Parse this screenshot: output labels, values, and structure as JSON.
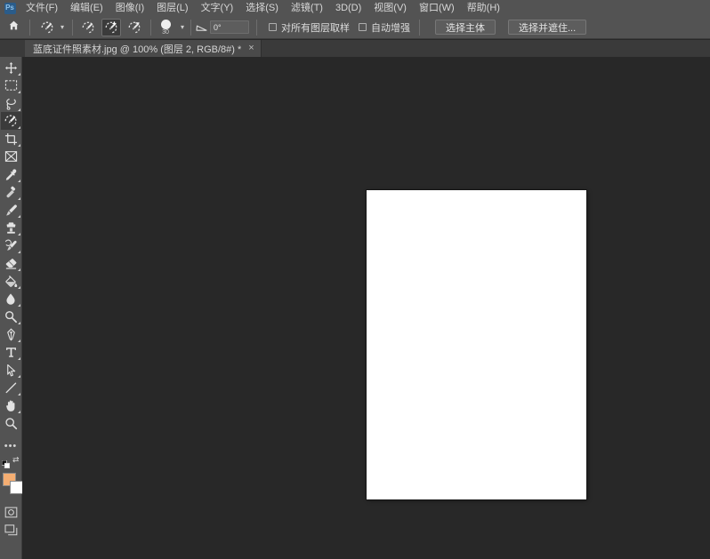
{
  "app": {
    "name": "Adobe Photoshop",
    "logo_text": "Ps",
    "colors": {
      "menubar_bg": "#535353",
      "toolbar_bg": "#535353",
      "canvas_bg": "#282828",
      "tabbar_bg": "#3a3a3a",
      "tab_active_bg": "#4a4a4a",
      "text": "#d8d8d8",
      "foreground_swatch": "#f5ae72",
      "background_swatch": "#ffffff",
      "logo_blue": "#2a5c8a"
    }
  },
  "menubar": {
    "items": [
      {
        "label": "文件(F)",
        "name": "menu-file"
      },
      {
        "label": "编辑(E)",
        "name": "menu-edit"
      },
      {
        "label": "图像(I)",
        "name": "menu-image"
      },
      {
        "label": "图层(L)",
        "name": "menu-layer"
      },
      {
        "label": "文字(Y)",
        "name": "menu-type"
      },
      {
        "label": "选择(S)",
        "name": "menu-select"
      },
      {
        "label": "滤镜(T)",
        "name": "menu-filter"
      },
      {
        "label": "3D(D)",
        "name": "menu-3d"
      },
      {
        "label": "视图(V)",
        "name": "menu-view"
      },
      {
        "label": "窗口(W)",
        "name": "menu-window"
      },
      {
        "label": "帮助(H)",
        "name": "menu-help"
      }
    ]
  },
  "options_bar": {
    "home_icon": "home-icon",
    "tool_preset_icon": "quick-selection-icon",
    "tool_preset_chevron": "chevron-down-icon",
    "modes": [
      {
        "name": "new-selection-mode",
        "icon": "quick-selection-new-icon",
        "active": false
      },
      {
        "name": "add-to-selection-mode",
        "icon": "quick-selection-add-icon",
        "active": true
      },
      {
        "name": "subtract-from-selection-mode",
        "icon": "quick-selection-subtract-icon",
        "active": false
      }
    ],
    "brush_size": "30",
    "brush_chevron": "chevron-down-icon",
    "angle_icon": "angle-icon",
    "angle_value": "0°",
    "checkboxes": [
      {
        "label": "对所有图层取样",
        "name": "sample-all-layers-checkbox",
        "checked": false
      },
      {
        "label": "自动增强",
        "name": "auto-enhance-checkbox",
        "checked": false
      }
    ],
    "buttons": [
      {
        "label": "选择主体",
        "name": "select-subject-button"
      },
      {
        "label": "选择并遮住...",
        "name": "select-and-mask-button"
      }
    ]
  },
  "tabbar": {
    "tabs": [
      {
        "label": "蓝底证件照素材.jpg @ 100% (图层 2, RGB/8#) *",
        "close_icon": "×",
        "name": "document-tab",
        "active": true
      }
    ]
  },
  "toolbar": {
    "tools": [
      {
        "name": "tool-move",
        "icon": "move-icon",
        "selected": false,
        "has_submenu": true
      },
      {
        "name": "tool-rectangular-marquee",
        "icon": "rectangular-marquee-icon",
        "selected": false,
        "has_submenu": true
      },
      {
        "name": "tool-lasso",
        "icon": "lasso-icon",
        "selected": false,
        "has_submenu": true
      },
      {
        "name": "tool-quick-selection",
        "icon": "quick-selection-icon",
        "selected": true,
        "has_submenu": true
      },
      {
        "name": "tool-crop",
        "icon": "crop-icon",
        "selected": false,
        "has_submenu": true
      },
      {
        "name": "tool-frame",
        "icon": "frame-icon",
        "selected": false,
        "has_submenu": false
      },
      {
        "name": "tool-eyedropper",
        "icon": "eyedropper-icon",
        "selected": false,
        "has_submenu": true
      },
      {
        "name": "tool-spot-healing-brush",
        "icon": "spot-healing-brush-icon",
        "selected": false,
        "has_submenu": true
      },
      {
        "name": "tool-brush",
        "icon": "brush-icon",
        "selected": false,
        "has_submenu": true
      },
      {
        "name": "tool-clone-stamp",
        "icon": "clone-stamp-icon",
        "selected": false,
        "has_submenu": true
      },
      {
        "name": "tool-history-brush",
        "icon": "history-brush-icon",
        "selected": false,
        "has_submenu": true
      },
      {
        "name": "tool-eraser",
        "icon": "eraser-icon",
        "selected": false,
        "has_submenu": true
      },
      {
        "name": "tool-gradient",
        "icon": "gradient-paint-bucket-icon",
        "selected": false,
        "has_submenu": true
      },
      {
        "name": "tool-blur",
        "icon": "blur-droplet-icon",
        "selected": false,
        "has_submenu": true
      },
      {
        "name": "tool-dodge",
        "icon": "dodge-icon",
        "selected": false,
        "has_submenu": true
      },
      {
        "name": "tool-pen",
        "icon": "pen-icon",
        "selected": false,
        "has_submenu": true
      },
      {
        "name": "tool-type",
        "icon": "type-t-icon",
        "selected": false,
        "has_submenu": true
      },
      {
        "name": "tool-path-selection",
        "icon": "path-selection-arrow-icon",
        "selected": false,
        "has_submenu": true
      },
      {
        "name": "tool-shape-line",
        "icon": "line-shape-icon",
        "selected": false,
        "has_submenu": true
      },
      {
        "name": "tool-hand",
        "icon": "hand-icon",
        "selected": false,
        "has_submenu": true
      },
      {
        "name": "tool-zoom",
        "icon": "zoom-magnifier-icon",
        "selected": false,
        "has_submenu": false
      }
    ],
    "more_tools_icon": "ellipsis-icon",
    "default_colors_icon": "default-colors-icon",
    "swap_colors_icon": "swap-colors-icon",
    "foreground_color": "#f5ae72",
    "background_color": "#ffffff",
    "quick_mask_icon": "quick-mask-icon",
    "screen_mode_icon": "screen-mode-icon"
  },
  "canvas": {
    "document_color": "#ffffff",
    "zoom": "100%"
  }
}
